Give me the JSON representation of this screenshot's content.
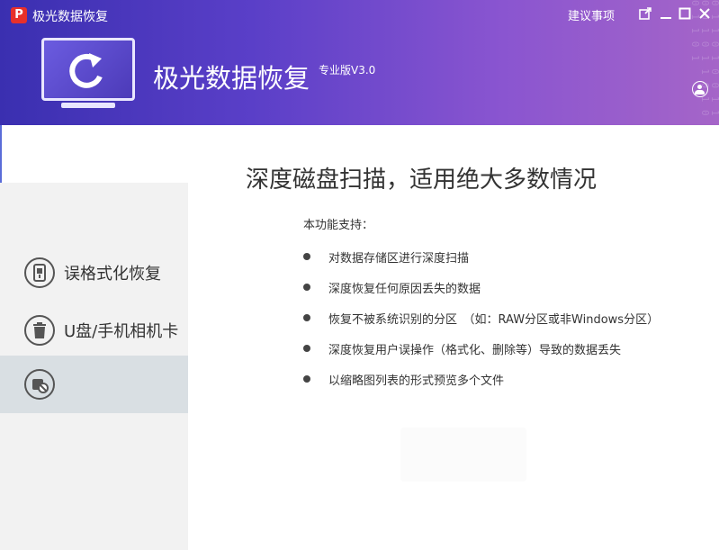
{
  "window": {
    "title": "极光数据恢复",
    "logo_letter": "P",
    "suggest_label": "建议事项"
  },
  "header": {
    "app_name": "极光数据恢复",
    "edition": "专业版V3.0",
    "matrix_text": "0 1 1 0 1 0 0 1 1 0 0 1 0 1 1 0 1 0 0 1 1 0 1"
  },
  "sidebar": {
    "items": [
      {
        "label": "误格式化恢复",
        "icon": "usb-drive-icon"
      },
      {
        "label": "U盘/手机相机卡",
        "icon": "trash-icon"
      },
      {
        "label": "",
        "icon": "disk-scan-icon"
      }
    ]
  },
  "main": {
    "heading": "深度磁盘扫描，适用绝大多数情况",
    "support_title": "本功能支持：",
    "features": [
      "对数据存储区进行深度扫描",
      "深度恢复任何原因丢失的数据",
      "恢复不被系统识别的分区　（如：RAW分区或非Windows分区）",
      "深度恢复用户误操作（格式化、删除等）导致的数据丢失",
      "以缩略图列表的形式预览多个文件"
    ]
  },
  "colors": {
    "header_start": "#3a2fb0",
    "header_end": "#a565c8",
    "sidebar_bg": "#f2f2f2",
    "active_item_bg": "#d9dfe3"
  }
}
